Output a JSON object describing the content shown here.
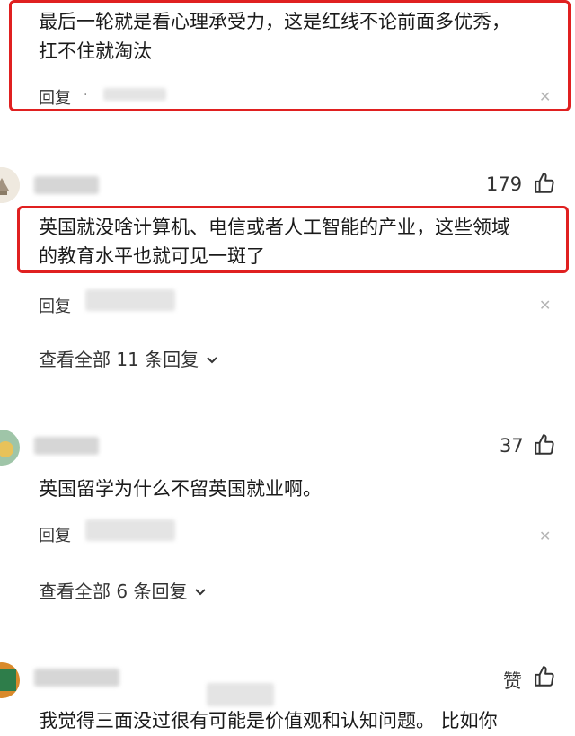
{
  "comments": [
    {
      "text_line1": "最后一轮就是看心理承受力，这是红线不论前面多优秀，",
      "text_line2": "扛不住就淘汰",
      "reply_label": "回复",
      "dot": "·"
    },
    {
      "likes": "179",
      "text_line1": "英国就没啥计算机、电信或者人工智能的产业，这些领域",
      "text_line2": "的教育水平也就可见一斑了",
      "reply_label": "回复",
      "see_all": "查看全部 11 条回复"
    },
    {
      "likes": "37",
      "text_line1": "英国留学为什么不留英国就业啊。",
      "reply_label": "回复",
      "see_all": "查看全部 6 条回复"
    },
    {
      "likes": "赞",
      "text_line1": "我觉得三面没过很有可能是价值观和认知问题。 比如你"
    }
  ],
  "icons": {
    "like": "thumbs-up-icon",
    "close": "close-icon",
    "chevron": "chevron-down-icon"
  },
  "colors": {
    "highlight": "#e02020",
    "text": "#1a1a1a"
  }
}
